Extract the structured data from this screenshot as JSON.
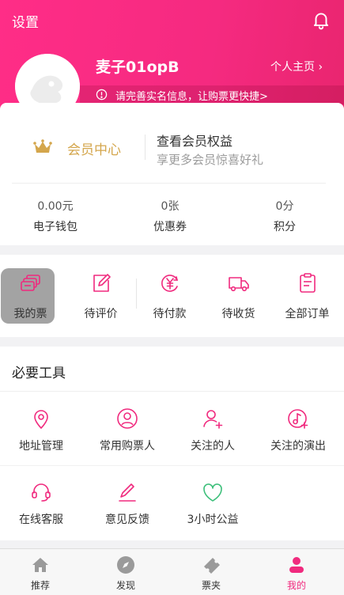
{
  "header": {
    "title": "设置",
    "username": "麦子01opB",
    "homepage_link": "个人主页 ›",
    "banner_text": "请完善实名信息，让购票更快捷>"
  },
  "membership": {
    "label": "会员中心",
    "title": "查看会员权益",
    "subtitle": "享更多会员惊喜好礼"
  },
  "stats": [
    {
      "value": "0.00元",
      "label": "电子钱包"
    },
    {
      "value": "0张",
      "label": "优惠券"
    },
    {
      "value": "0分",
      "label": "积分"
    }
  ],
  "orders": [
    {
      "label": "我的票",
      "icon": "ticket-stack-icon"
    },
    {
      "label": "待评价",
      "icon": "edit-icon"
    },
    {
      "label": "待付款",
      "icon": "yen-icon"
    },
    {
      "label": "待收货",
      "icon": "truck-icon"
    },
    {
      "label": "全部订单",
      "icon": "clipboard-icon"
    }
  ],
  "tools": {
    "title": "必要工具",
    "items": [
      {
        "label": "地址管理",
        "icon": "location-pin-icon"
      },
      {
        "label": "常用购票人",
        "icon": "user-circle-icon"
      },
      {
        "label": "关注的人",
        "icon": "user-add-icon"
      },
      {
        "label": "关注的演出",
        "icon": "music-note-add-icon"
      },
      {
        "label": "在线客服",
        "icon": "headset-icon"
      },
      {
        "label": "意见反馈",
        "icon": "pen-icon"
      },
      {
        "label": "3小时公益",
        "icon": "leaf-heart-icon"
      }
    ]
  },
  "tabbar": {
    "items": [
      {
        "label": "推荐",
        "icon": "home-icon"
      },
      {
        "label": "发现",
        "icon": "compass-icon"
      },
      {
        "label": "票夹",
        "icon": "ticket-icon"
      },
      {
        "label": "我的",
        "icon": "profile-icon"
      }
    ],
    "active": "我的"
  },
  "colors": {
    "brand": "#f02a7e",
    "gold": "#d4a64c",
    "inactive_tab": "#9a9a9a"
  }
}
